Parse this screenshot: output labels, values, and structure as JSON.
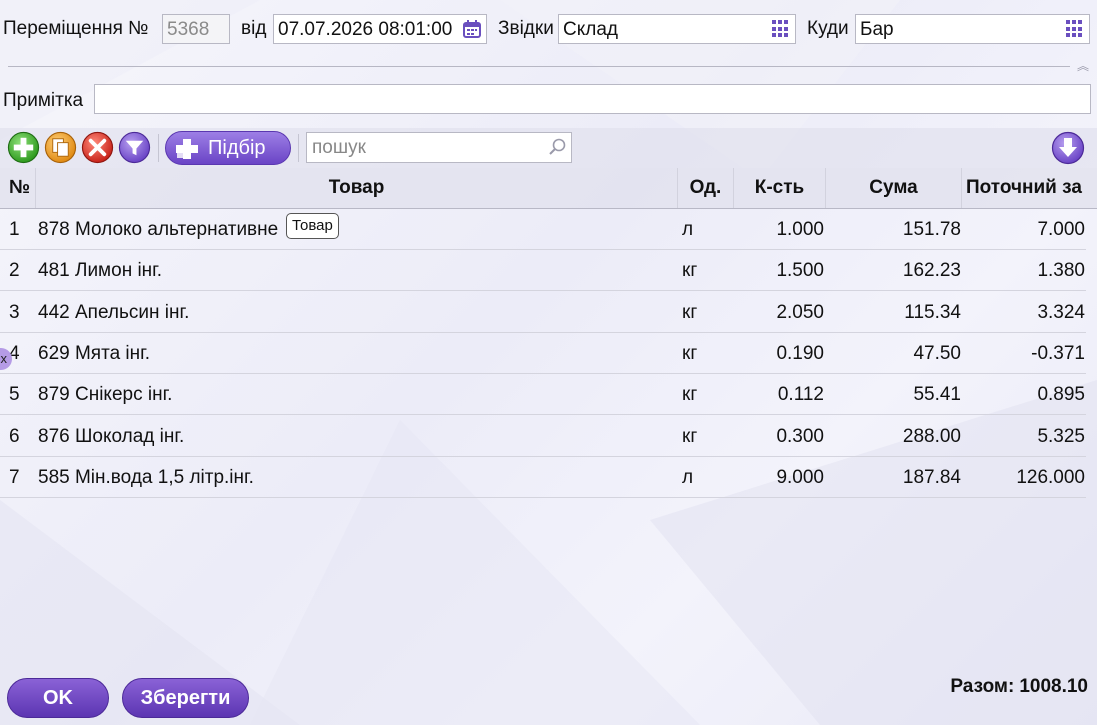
{
  "header": {
    "doc_label": "Переміщення №",
    "doc_number": "5368",
    "date_label": "від",
    "date_value": "07.07.2026 08:01:00",
    "from_label": "Звідки",
    "from_value": "Склад",
    "to_label": "Куди",
    "to_value": "Бар"
  },
  "note": {
    "label": "Примітка",
    "value": ""
  },
  "toolbar": {
    "add_icon": "add-icon",
    "copy_icon": "copy-icon",
    "delete_icon": "delete-icon",
    "filter_icon": "filter-icon",
    "pick_label": "Підбір",
    "search_placeholder": "пошук",
    "download_icon": "arrow-down-icon"
  },
  "table": {
    "columns": [
      "№",
      "Товар",
      "Од.",
      "К-сть",
      "Сума",
      "Поточний за"
    ],
    "rows": [
      {
        "num": "1",
        "item": "878 Молоко альтернативне",
        "unit": "л",
        "qty": "1.000",
        "sum": "151.78",
        "current": "7.000"
      },
      {
        "num": "2",
        "item": "481 Лимон інг.",
        "unit": "кг",
        "qty": "1.500",
        "sum": "162.23",
        "current": "1.380"
      },
      {
        "num": "3",
        "item": "442 Апельсин інг.",
        "unit": "кг",
        "qty": "2.050",
        "sum": "115.34",
        "current": "3.324"
      },
      {
        "num": "4",
        "item": "629 Мята інг.",
        "unit": "кг",
        "qty": "0.190",
        "sum": "47.50",
        "current": "-0.371"
      },
      {
        "num": "5",
        "item": "879 Снікерс інг.",
        "unit": "кг",
        "qty": "0.112",
        "sum": "55.41",
        "current": "0.895"
      },
      {
        "num": "6",
        "item": "876 Шоколад інг.",
        "unit": "кг",
        "qty": "0.300",
        "sum": "288.00",
        "current": "5.325"
      },
      {
        "num": "7",
        "item": "585 Мін.вода 1,5 літр.інг.",
        "unit": "л",
        "qty": "9.000",
        "sum": "187.84",
        "current": "126.000"
      }
    ]
  },
  "tooltip": "Товар",
  "side_handle": "x",
  "footer": {
    "ok_label": "OK",
    "save_label": "Зберегти",
    "total_label": "Разом:",
    "total_value": "1008.10"
  }
}
